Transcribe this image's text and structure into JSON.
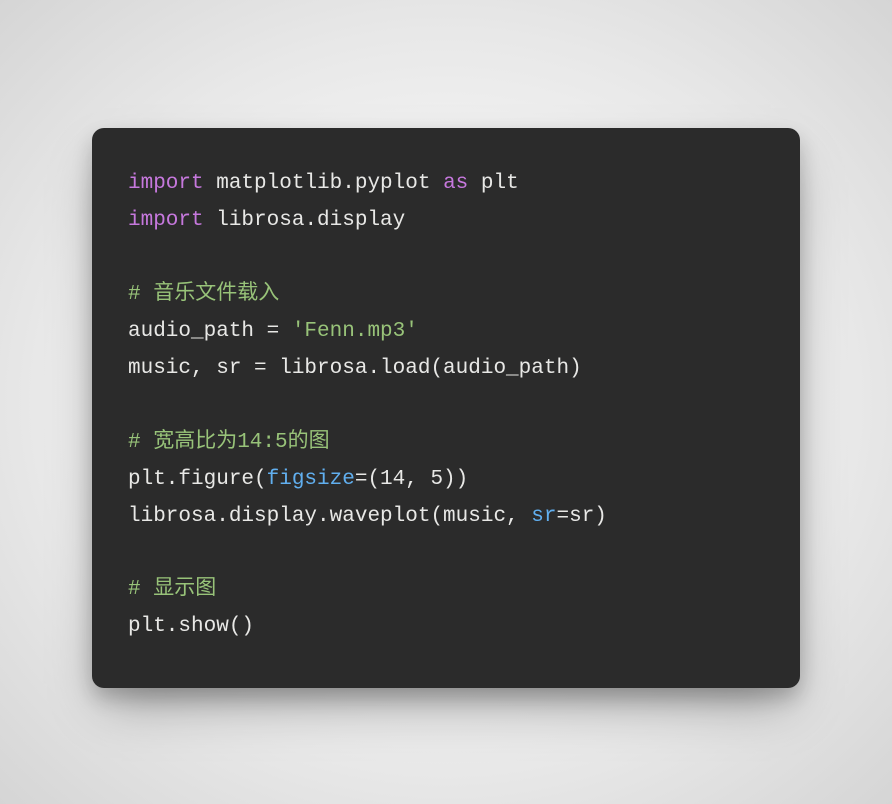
{
  "code": {
    "lines": [
      {
        "tokens": [
          {
            "cls": "kw",
            "t": "import"
          },
          {
            "cls": "txt",
            "t": " matplotlib.pyplot "
          },
          {
            "cls": "kw",
            "t": "as"
          },
          {
            "cls": "txt",
            "t": " plt"
          }
        ]
      },
      {
        "tokens": [
          {
            "cls": "kw",
            "t": "import"
          },
          {
            "cls": "txt",
            "t": " librosa.display"
          }
        ]
      },
      {
        "tokens": [
          {
            "cls": "txt",
            "t": ""
          }
        ]
      },
      {
        "tokens": [
          {
            "cls": "cm",
            "t": "# 音乐文件载入"
          }
        ]
      },
      {
        "tokens": [
          {
            "cls": "txt",
            "t": "audio_path = "
          },
          {
            "cls": "str",
            "t": "'Fenn.mp3'"
          }
        ]
      },
      {
        "tokens": [
          {
            "cls": "txt",
            "t": "music, sr = librosa.load(audio_path)"
          }
        ]
      },
      {
        "tokens": [
          {
            "cls": "txt",
            "t": ""
          }
        ]
      },
      {
        "tokens": [
          {
            "cls": "cm",
            "t": "# 宽高比为14:5的图"
          }
        ]
      },
      {
        "tokens": [
          {
            "cls": "txt",
            "t": "plt.figure("
          },
          {
            "cls": "arg",
            "t": "figsize"
          },
          {
            "cls": "txt",
            "t": "=(14, 5))"
          }
        ]
      },
      {
        "tokens": [
          {
            "cls": "txt",
            "t": "librosa.display.waveplot(music, "
          },
          {
            "cls": "arg",
            "t": "sr"
          },
          {
            "cls": "txt",
            "t": "=sr)"
          }
        ]
      },
      {
        "tokens": [
          {
            "cls": "txt",
            "t": ""
          }
        ]
      },
      {
        "tokens": [
          {
            "cls": "cm",
            "t": "# 显示图"
          }
        ]
      },
      {
        "tokens": [
          {
            "cls": "txt",
            "t": "plt.show()"
          }
        ]
      }
    ]
  }
}
